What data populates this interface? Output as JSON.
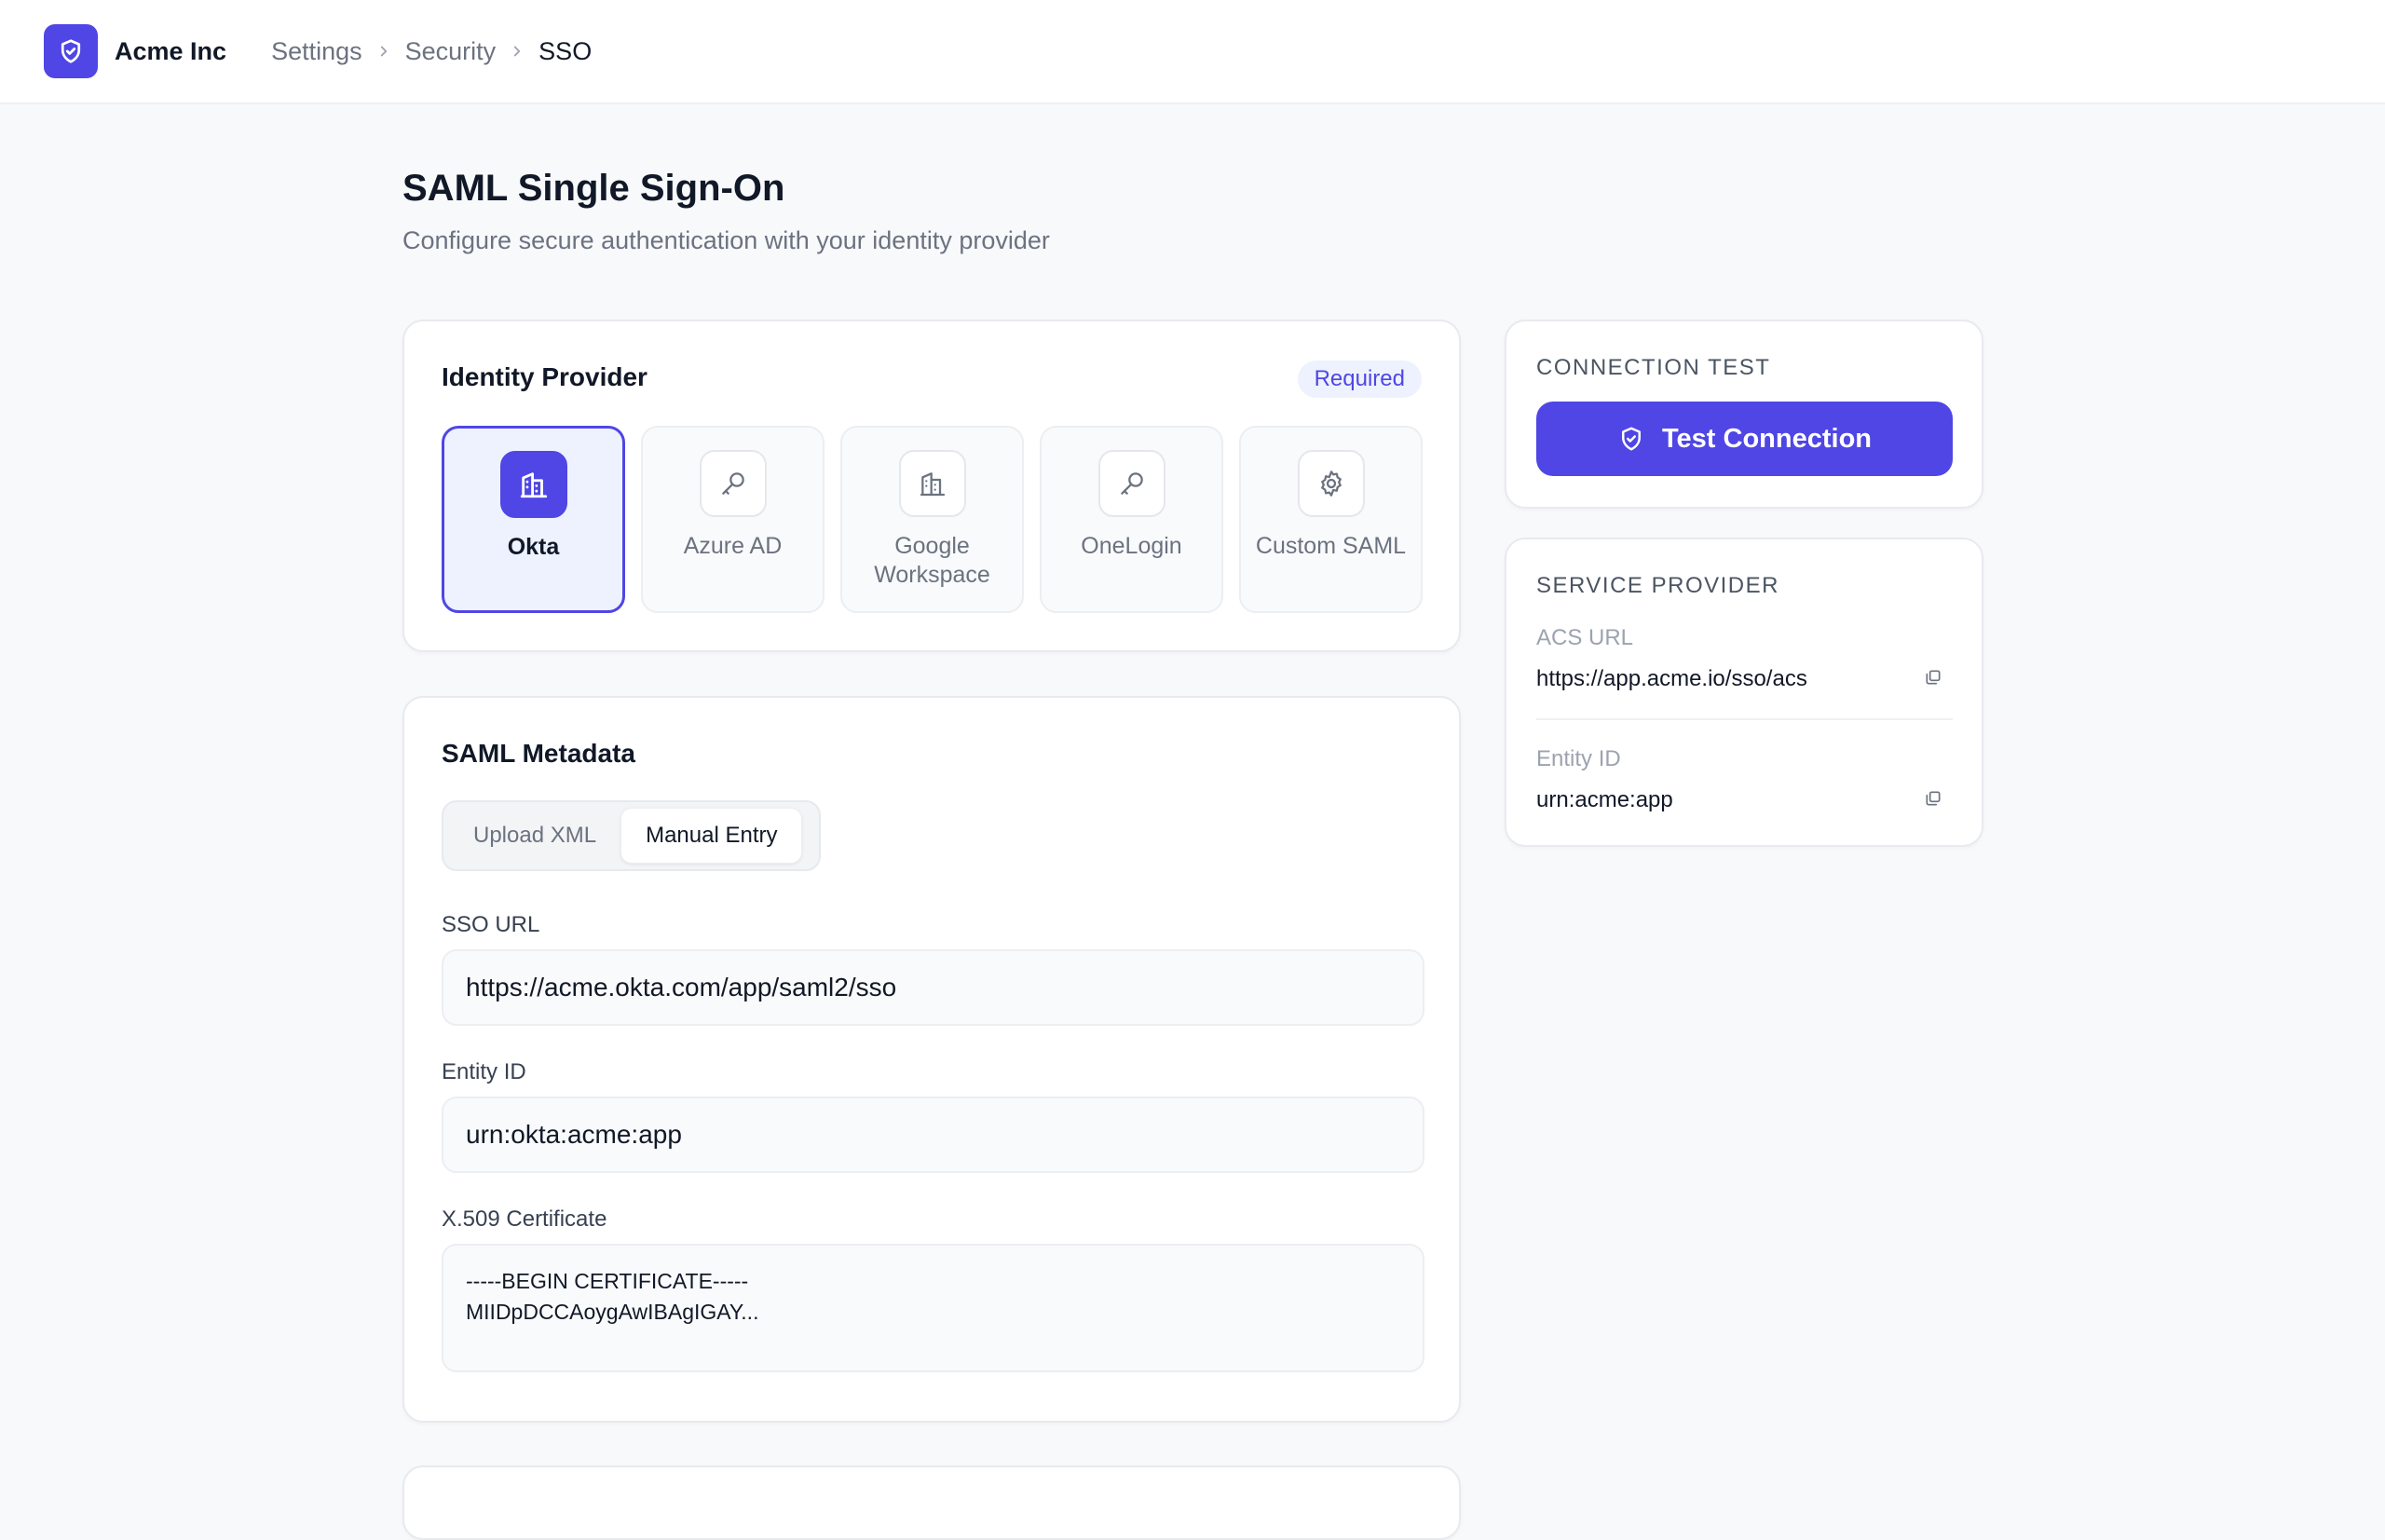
{
  "app": {
    "brand": "Acme Inc",
    "accent": "#4f46e5"
  },
  "breadcrumb": {
    "items": [
      "Settings",
      "Security",
      "SSO"
    ]
  },
  "page": {
    "title": "SAML Single Sign-On",
    "subtitle": "Configure secure authentication with your identity provider"
  },
  "identity_provider": {
    "title": "Identity Provider",
    "badge": "Required",
    "options": [
      {
        "label": "Okta",
        "icon": "building-icon",
        "selected": true
      },
      {
        "label": "Azure AD",
        "icon": "key-icon",
        "selected": false
      },
      {
        "label": "Google Workspace",
        "icon": "building-icon",
        "selected": false
      },
      {
        "label": "OneLogin",
        "icon": "key-icon",
        "selected": false
      },
      {
        "label": "Custom SAML",
        "icon": "gear-icon",
        "selected": false
      }
    ]
  },
  "metadata": {
    "title": "SAML Metadata",
    "tabs": [
      {
        "label": "Upload XML",
        "active": false
      },
      {
        "label": "Manual Entry",
        "active": true
      }
    ],
    "sso_url": {
      "label": "SSO URL",
      "value": "https://acme.okta.com/app/saml2/sso"
    },
    "entity_id": {
      "label": "Entity ID",
      "value": "urn:okta:acme:app"
    },
    "certificate": {
      "label": "X.509 Certificate",
      "line1": "-----BEGIN CERTIFICATE-----",
      "line2": "MIIDpDCCAoygAwIBAgIGAY..."
    }
  },
  "connection_test": {
    "title": "CONNECTION TEST",
    "button_label": "Test Connection"
  },
  "service_provider": {
    "title": "SERVICE PROVIDER",
    "acs_label": "ACS URL",
    "acs_value": "https://app.acme.io/sso/acs",
    "entity_label": "Entity ID",
    "entity_value": "urn:acme:app"
  }
}
